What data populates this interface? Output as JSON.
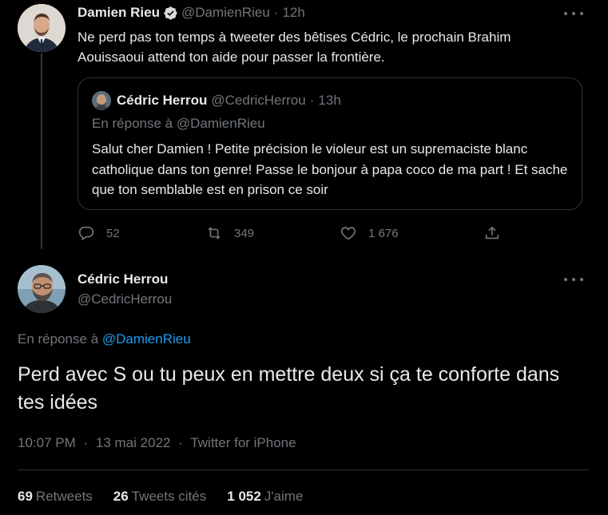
{
  "tweet1": {
    "name": "Damien Rieu",
    "handle": "@DamienRieu",
    "time": "12h",
    "text": "Ne perd pas ton temps à tweeter des bêtises Cédric, le prochain Brahim Aouissaoui attend ton aide pour passer la frontière.",
    "avatar_icon": "avatar-damien-rieu",
    "verified_icon": "verified-badge-icon",
    "quote": {
      "name": "Cédric Herrou",
      "handle": "@CedricHerrou",
      "time": "13h",
      "reply_prefix": "En réponse à",
      "reply_handle": "@DamienRieu",
      "text": "Salut cher Damien ! Petite précision le violeur est un supremaciste blanc catholique dans ton genre! Passe le bonjour à papa coco de ma part ! Et sache que ton semblable est en prison ce soir"
    },
    "actions": {
      "replies": "52",
      "retweets": "349",
      "likes": "1 676"
    }
  },
  "tweet2": {
    "name": "Cédric Herrou",
    "handle": "@CedricHerrou",
    "reply_prefix": "En réponse à",
    "reply_handle": "@DamienRieu",
    "text": "Perd avec S ou tu peux en mettre deux si ça te conforte dans tes idées",
    "timestamp": "10:07 PM",
    "date": "13 mai 2022",
    "source": "Twitter for iPhone",
    "separator": "·",
    "stats": {
      "retweets_count": "69",
      "retweets_label": "Retweets",
      "quotes_count": "26",
      "quotes_label": "Tweets cités",
      "likes_count": "1 052",
      "likes_label": "J'aime"
    }
  },
  "colors": {
    "background": "#000000",
    "text": "#e7e9ea",
    "muted": "#71767b",
    "accent": "#1d9bf0",
    "border": "#2f3336"
  }
}
